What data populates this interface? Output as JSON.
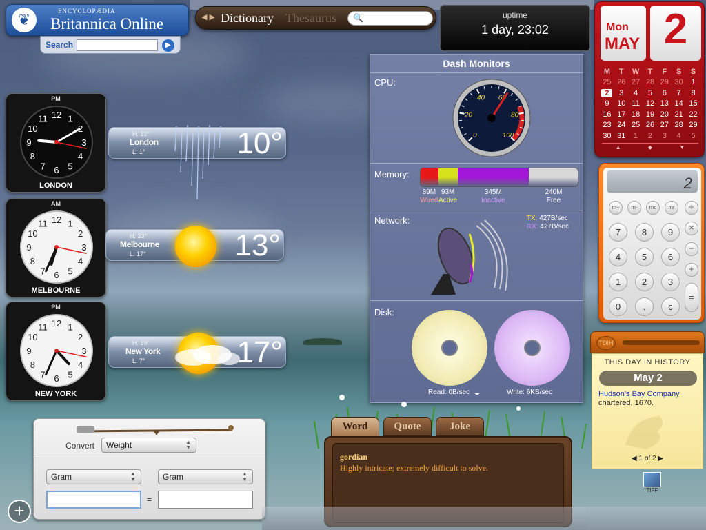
{
  "britannica": {
    "logo_glyph": "❦",
    "encyclopaedia": "ENCYCLOPÆDIA",
    "name": "Britannica Online",
    "search_label": "Search",
    "search_value": "",
    "go_glyph": "▶"
  },
  "dictionary": {
    "arrows": "◀ ▶",
    "dictionary_label": "Dictionary",
    "thesaurus_label": "Thesaurus",
    "search_value": "",
    "search_glyph": "🔍"
  },
  "uptime": {
    "label": "uptime",
    "value": "1 day, 23:02"
  },
  "calendar": {
    "weekday": "Mon",
    "month": "MAY",
    "day": "2",
    "weekday_headers": [
      "M",
      "T",
      "W",
      "T",
      "F",
      "S",
      "S"
    ],
    "weeks": [
      [
        "25",
        "26",
        "27",
        "28",
        "29",
        "30",
        "1"
      ],
      [
        "2",
        "3",
        "4",
        "5",
        "6",
        "7",
        "8"
      ],
      [
        "9",
        "10",
        "11",
        "12",
        "13",
        "14",
        "15"
      ],
      [
        "16",
        "17",
        "18",
        "19",
        "20",
        "21",
        "22"
      ],
      [
        "23",
        "24",
        "25",
        "26",
        "27",
        "28",
        "29"
      ],
      [
        "30",
        "31",
        "1",
        "2",
        "3",
        "4",
        "5"
      ]
    ],
    "nav": [
      "▲",
      "◆",
      "▼"
    ]
  },
  "calculator": {
    "display": "2",
    "memory_keys": [
      "m+",
      "m-",
      "mc",
      "mr"
    ],
    "op_keys": [
      "÷",
      "×",
      "−",
      "+"
    ],
    "number_rows": [
      [
        "7",
        "8",
        "9"
      ],
      [
        "4",
        "5",
        "6"
      ],
      [
        "1",
        "2",
        "3"
      ],
      [
        "0",
        ".",
        "c"
      ]
    ],
    "equals": "="
  },
  "clocks": [
    {
      "ampm": "PM",
      "city": "LONDON",
      "hour": 9,
      "minute": 10,
      "second": 17,
      "face": "dark"
    },
    {
      "ampm": "AM",
      "city": "MELBOURNE",
      "hour": 6,
      "minute": 34,
      "second": 17,
      "face": "light"
    },
    {
      "ampm": "PM",
      "city": "NEW YORK",
      "hour": 4,
      "minute": 34,
      "second": 17,
      "face": "light"
    }
  ],
  "clock_numbers": [
    "12",
    "1",
    "2",
    "3",
    "4",
    "5",
    "6",
    "7",
    "8",
    "9",
    "10",
    "11"
  ],
  "weather": [
    {
      "city": "London",
      "high": "H: 12°",
      "low": "L: 1°",
      "temp": "10°",
      "condition": "rain"
    },
    {
      "city": "Melbourne",
      "high": "H: 23°",
      "low": "L: 17°",
      "temp": "13°",
      "condition": "sunny"
    },
    {
      "city": "New York",
      "high": "H: 19°",
      "low": "L: 7°",
      "temp": "17°",
      "condition": "partly-cloudy"
    }
  ],
  "converter": {
    "convert_label": "Convert",
    "category": "Weight",
    "from_unit": "Gram",
    "to_unit": "Gram",
    "from_value": "",
    "to_value": "",
    "equals": "="
  },
  "dash": {
    "title": "Dash Monitors",
    "cpu_label": "CPU:",
    "cpu_percent": 62,
    "gauge_ticks": [
      "0",
      "20",
      "40",
      "60",
      "80",
      "100"
    ],
    "memory_label": "Memory:",
    "memory": [
      {
        "size": "89M",
        "name": "Wired",
        "value": 89,
        "color": "#e81818"
      },
      {
        "size": "93M",
        "name": "Active",
        "value": 93,
        "color": "#d8e21a"
      },
      {
        "size": "345M",
        "name": "Inactive",
        "value": 345,
        "color": "#a317d8"
      },
      {
        "size": "240M",
        "name": "Free",
        "value": 240,
        "color": "#d8d8d8"
      }
    ],
    "network_label": "Network:",
    "tx_label": "TX:",
    "tx_value": "427B/sec",
    "rx_label": "RX:",
    "rx_value": "427B/sec",
    "disk_label": "Disk:",
    "read_label": "Read: 0B/sec",
    "write_label": "Write: 6KB/sec"
  },
  "word_widget": {
    "tabs": [
      "Word",
      "Quote",
      "Joke"
    ],
    "word": "gordian",
    "definition": "Highly intricate; extremely difficult to solve."
  },
  "history": {
    "badge": "TDIH",
    "heading": "THIS DAY IN HISTORY",
    "date": "May 2",
    "link": "Hudson's Bay Company",
    "event": "chartered, 1670.",
    "pagination": "1 of 2"
  },
  "desktop": {
    "add_widget_glyph": "+",
    "tiff_label": "TIFF"
  },
  "colors": {
    "accent_red": "#c8141b",
    "calc_orange": "#ff8b2c",
    "brit_blue": "#1e4e99"
  }
}
